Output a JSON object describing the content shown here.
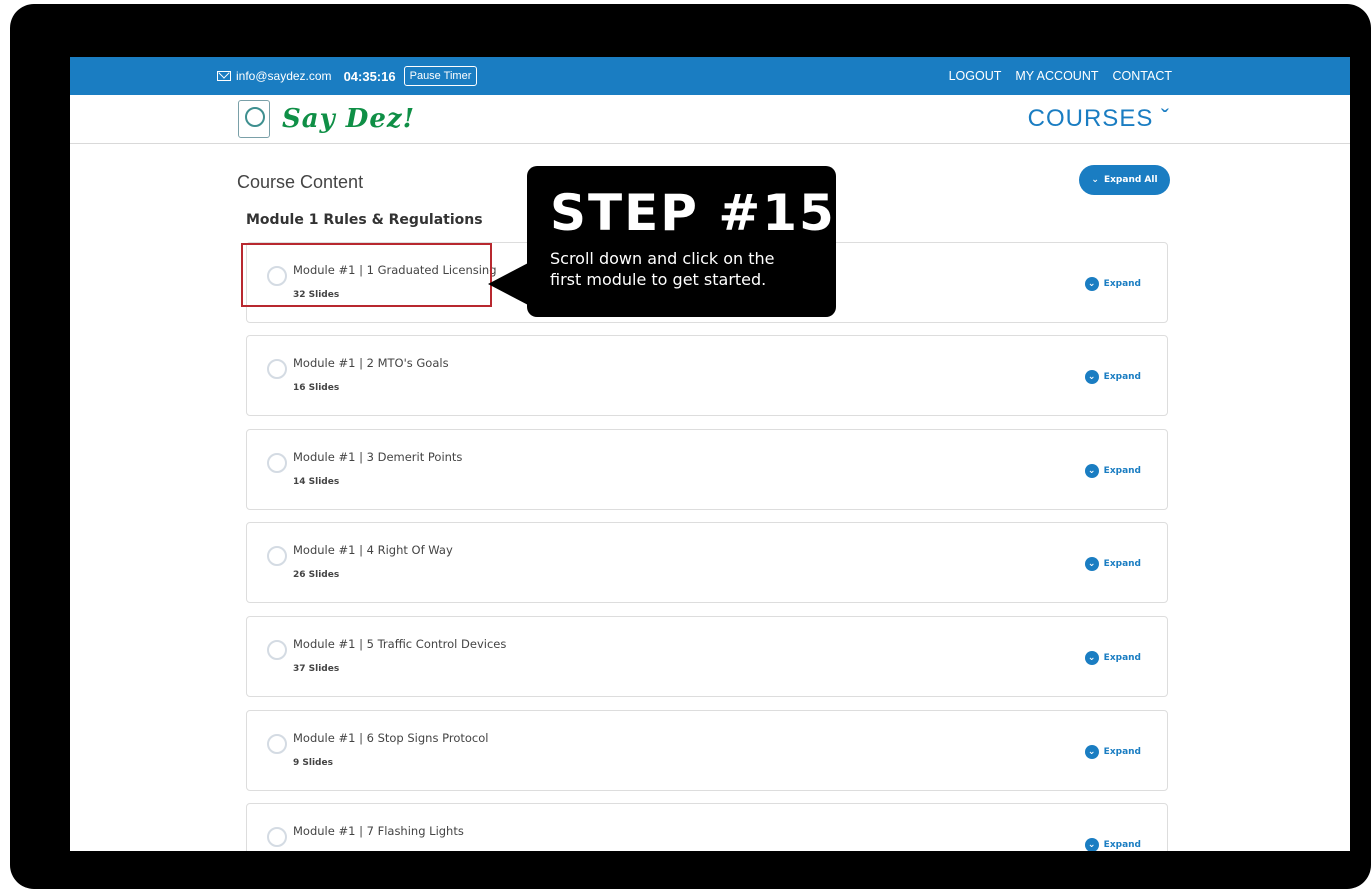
{
  "topbar": {
    "email": "info@saydez.com",
    "timer": "04:35:16",
    "pause_label": "Pause Timer",
    "links": [
      "LOGOUT",
      "MY ACCOUNT",
      "CONTACT"
    ]
  },
  "header": {
    "logo_text": "Say Dez!",
    "courses_menu": "COURSES ˇ"
  },
  "content": {
    "title": "Course Content",
    "expand_all_label": "Expand All",
    "module_heading": "Module 1 Rules & Regulations",
    "expand_label": "Expand",
    "items": [
      {
        "title": "Module #1 | 1 Graduated Licensing",
        "slides": "32 Slides"
      },
      {
        "title": "Module #1 | 2 MTO's Goals",
        "slides": "16 Slides"
      },
      {
        "title": "Module #1 | 3 Demerit Points",
        "slides": "14 Slides"
      },
      {
        "title": "Module #1 | 4 Right Of Way",
        "slides": "26 Slides"
      },
      {
        "title": "Module #1 | 5 Traffic Control Devices",
        "slides": "37 Slides"
      },
      {
        "title": "Module #1 | 6 Stop Signs Protocol",
        "slides": "9 Slides"
      },
      {
        "title": "Module #1 | 7 Flashing Lights",
        "slides": ""
      }
    ]
  },
  "callout": {
    "step": "STEP #15",
    "text_line1": "Scroll down and click on the",
    "text_line2": "first module to get started."
  },
  "colors": {
    "brand_blue": "#1a7dc2",
    "logo_green": "#0f8f46",
    "highlight_red": "#b8282f"
  }
}
